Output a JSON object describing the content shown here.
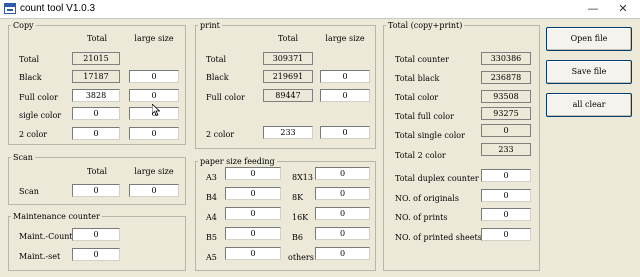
{
  "window": {
    "title": "count tool V1.0.3",
    "minimize": "—",
    "close": "✕"
  },
  "headers": {
    "total": "Total",
    "large_size": "large size"
  },
  "copy": {
    "legend": "Copy",
    "rows": [
      {
        "label": "Total",
        "total": "21015"
      },
      {
        "label": "Black",
        "total": "17187",
        "large": "0"
      },
      {
        "label": "Full color",
        "total": "3828",
        "large": "0"
      },
      {
        "label": "sigle color",
        "total": "0",
        "large": "0"
      },
      {
        "label": "2 color",
        "total": "0",
        "large": "0"
      }
    ]
  },
  "print": {
    "legend": "print",
    "rows": [
      {
        "label": "Total",
        "total": "309371"
      },
      {
        "label": "Black",
        "total": "219691",
        "large": "0"
      },
      {
        "label": "Full color",
        "total": "89447",
        "large": "0"
      },
      {
        "label": "2 color",
        "total": "233",
        "large": "0"
      }
    ]
  },
  "scan": {
    "legend": "Scan",
    "label": "Scan",
    "total": "0",
    "large": "0"
  },
  "maintenance": {
    "legend": "Maintenance counter",
    "count_label": "Maint.-Count",
    "count_value": "0",
    "set_label": "Maint.-set",
    "set_value": "0"
  },
  "paper": {
    "legend": "paper size feeding",
    "left": [
      {
        "label": "A3",
        "value": "0"
      },
      {
        "label": "B4",
        "value": "0"
      },
      {
        "label": "A4",
        "value": "0"
      },
      {
        "label": "B5",
        "value": "0"
      },
      {
        "label": "A5",
        "value": "0"
      }
    ],
    "right": [
      {
        "label": "8X13",
        "value": "0"
      },
      {
        "label": "8K",
        "value": "0"
      },
      {
        "label": "16K",
        "value": "0"
      },
      {
        "label": "B6",
        "value": "0"
      },
      {
        "label": "others",
        "value": "0"
      }
    ]
  },
  "summary": {
    "legend": "Total (copy+print)",
    "counter_label": "Total counter",
    "counter_value": "330386",
    "black_label": "Total black",
    "black_value": "236878",
    "color_label": "Total color",
    "color_value": "93508",
    "full_color_label": "Total full color",
    "full_color_value": "93275",
    "single_color_label": "Total single color",
    "single_color_value": "0",
    "two_color_label": "Total 2 color",
    "two_color_value": "233",
    "duplex_label": "Total duplex counter",
    "duplex_value": "0",
    "originals_label": "NO. of originals",
    "originals_value": "0",
    "prints_label": "NO. of prints",
    "prints_value": "0",
    "printed_sheets_label": "NO. of printed sheets",
    "printed_sheets_value": "0"
  },
  "buttons": {
    "open": "Open file",
    "save": "Save file",
    "clear": "all clear"
  }
}
